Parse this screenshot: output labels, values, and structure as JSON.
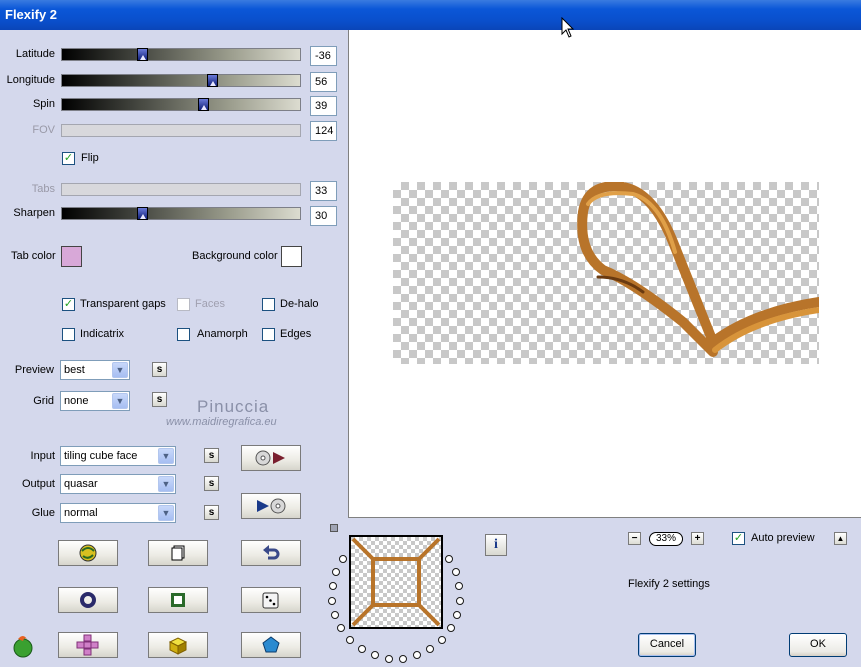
{
  "window": {
    "title": "Flexify 2"
  },
  "sliders": [
    {
      "label": "Latitude",
      "value": "-36",
      "level": 0.33,
      "enabled": true
    },
    {
      "label": "Longitude",
      "value": "56",
      "level": 0.64,
      "enabled": true
    },
    {
      "label": "Spin",
      "value": "39",
      "level": 0.6,
      "enabled": true
    },
    {
      "label": "FOV",
      "value": "124",
      "enabled": false
    },
    {
      "label": "Tabs",
      "value": "33",
      "enabled": false
    },
    {
      "label": "Sharpen",
      "value": "30",
      "level": 0.33,
      "enabled": true
    }
  ],
  "flip": {
    "label": "Flip",
    "checked": true
  },
  "tab_color": {
    "label": "Tab color",
    "color": "#d8a8d8"
  },
  "background_color": {
    "label": "Background color",
    "color": "#ffffff"
  },
  "options": {
    "transparent_gaps": {
      "label": "Transparent gaps",
      "checked": true
    },
    "faces": {
      "label": "Faces",
      "checked": false
    },
    "de_halo": {
      "label": "De-halo",
      "checked": false
    },
    "indicatrix": {
      "label": "Indicatrix",
      "checked": false
    },
    "anamorph": {
      "label": "Anamorph",
      "checked": false
    },
    "edges": {
      "label": "Edges",
      "checked": false
    }
  },
  "selects": {
    "preview": {
      "label": "Preview",
      "value": "best"
    },
    "grid": {
      "label": "Grid",
      "value": "none"
    },
    "input": {
      "label": "Input",
      "value": "tiling cube face"
    },
    "output": {
      "label": "Output",
      "value": "quasar"
    },
    "glue": {
      "label": "Glue",
      "value": "normal"
    }
  },
  "s_button_label": "s",
  "watermark": {
    "name": "Pinuccia",
    "site": "www.maidiregrafica.eu"
  },
  "zoom": {
    "value": "33%",
    "minus": "−",
    "plus": "+"
  },
  "auto_preview": {
    "label": "Auto preview",
    "checked": true
  },
  "collapse_label": "▲",
  "settings_label": "Flexify 2 settings",
  "info_label": "i",
  "buttons": {
    "cancel": "Cancel",
    "ok": "OK"
  },
  "colors": {
    "wood": "#b8742a",
    "titlebar": "#0a4fcb"
  }
}
